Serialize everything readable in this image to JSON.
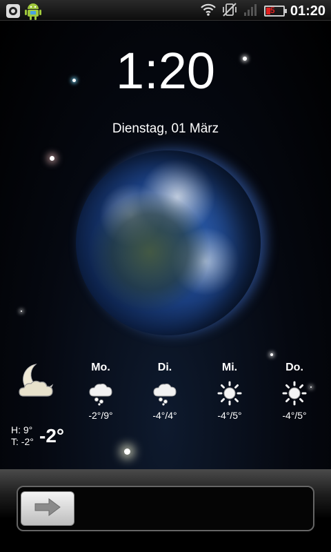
{
  "status_bar": {
    "time": "01:20",
    "battery_level": "5",
    "icons": [
      "notification-icon",
      "android-robot-icon",
      "wifi-icon",
      "vibrate-off-icon",
      "signal-bars-icon",
      "battery-icon"
    ]
  },
  "lockscreen": {
    "time": "1:20",
    "date": "Dienstag, 01 März"
  },
  "weather": {
    "current_icon": "moon-cloud-icon",
    "high": "H: 9°",
    "low": "T: -2°",
    "current_temp": "-2°",
    "forecast": [
      {
        "day": "Mo.",
        "icon": "snow-cloud-icon",
        "temp": "-2°/9°"
      },
      {
        "day": "Di.",
        "icon": "snow-cloud-icon",
        "temp": "-4°/4°"
      },
      {
        "day": "Mi.",
        "icon": "sun-icon",
        "temp": "-4°/5°"
      },
      {
        "day": "Do.",
        "icon": "sun-icon",
        "temp": "-4°/5°"
      }
    ]
  },
  "unlock": {
    "handle_icon": "arrow-right-icon"
  },
  "colors": {
    "background": "#000000",
    "battery_low": "#e02020",
    "earth_blue": "#2a5aa8"
  }
}
